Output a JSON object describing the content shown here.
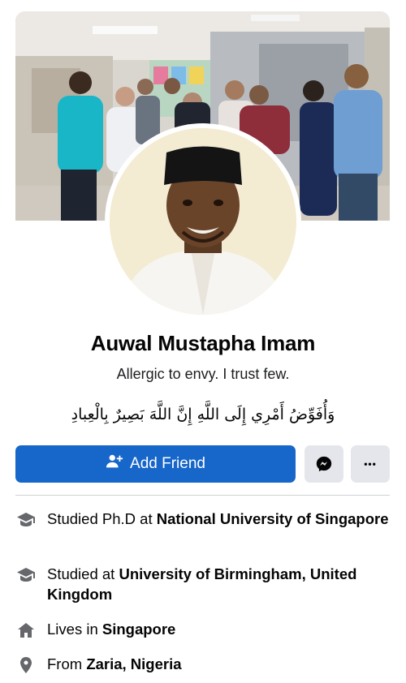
{
  "profile": {
    "name": "Auwal Mustapha Imam",
    "bio": "Allergic to envy. I trust few.",
    "arabic_line": "وَأُفَوِّضُ أَمْرِي إِلَى اللَّهِ إِنَّ اللَّهَ بَصِيرٌ بِالْعِبادِ"
  },
  "actions": {
    "add_friend_label": "Add Friend",
    "more_label": "•••"
  },
  "details": [
    {
      "icon": "graduation-cap-icon",
      "prefix": "Studied Ph.D at ",
      "value": "National University of Singapore"
    },
    {
      "icon": "graduation-cap-icon",
      "prefix": "Studied at ",
      "value": "University of Birmingham, United Kingdom"
    },
    {
      "icon": "home-icon",
      "prefix": "Lives in ",
      "value": "Singapore"
    },
    {
      "icon": "location-pin-icon",
      "prefix": "From ",
      "value": "Zaria, Nigeria"
    }
  ],
  "colors": {
    "primary_button": "#1766c9",
    "secondary_button": "#e4e6eb",
    "icon": "#65676b"
  }
}
